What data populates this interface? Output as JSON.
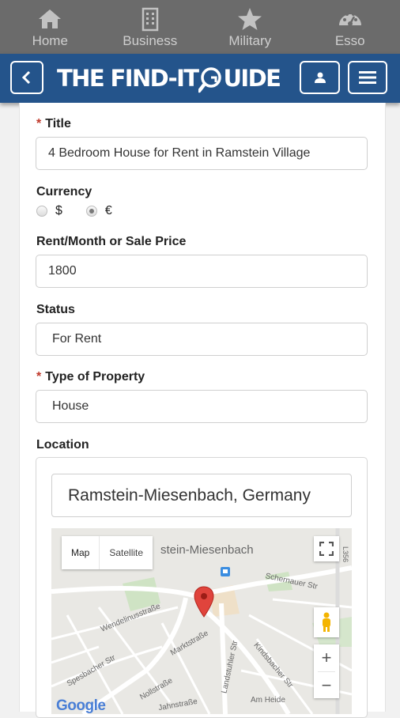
{
  "topnav": {
    "tabs": [
      {
        "label": "Home",
        "icon": "home-icon"
      },
      {
        "label": "Business",
        "icon": "building-icon"
      },
      {
        "label": "Military",
        "icon": "star-icon"
      },
      {
        "label": "Esso",
        "icon": "gauge-icon"
      }
    ]
  },
  "header": {
    "logo_part1": "THE FIND-IT",
    "logo_part2": "UIDE",
    "colors": {
      "bar": "#24548b",
      "topnav": "#6b6b6b"
    }
  },
  "form": {
    "title_label": "Title",
    "title_value": "4 Bedroom House for Rent in Ramstein Village",
    "currency_label": "Currency",
    "currency_options": [
      "$",
      "€"
    ],
    "currency_selected": "€",
    "price_label": "Rent/Month or Sale Price",
    "price_value": "1800",
    "status_label": "Status",
    "status_value": "For Rent",
    "property_label": "Type of Property",
    "property_value": "House",
    "location_label": "Location",
    "location_value": "Ramstein-Miesenbach, Germany",
    "required_mark": "*"
  },
  "map": {
    "type_map": "Map",
    "type_satellite": "Satellite",
    "town_label": "stein-Miesenbach",
    "road_code": "L356",
    "streets": [
      "Schernauer Str",
      "Wendelinusstraße",
      "Marktstraße",
      "Landstuhler Str",
      "Kindsbacher Str",
      "Spesbacher Str",
      "Nollstraße",
      "Jahnstraße",
      "Am Heide"
    ],
    "zoom_in": "+",
    "zoom_out": "−",
    "attribution": "Google",
    "marker_color": "#e0443c"
  }
}
